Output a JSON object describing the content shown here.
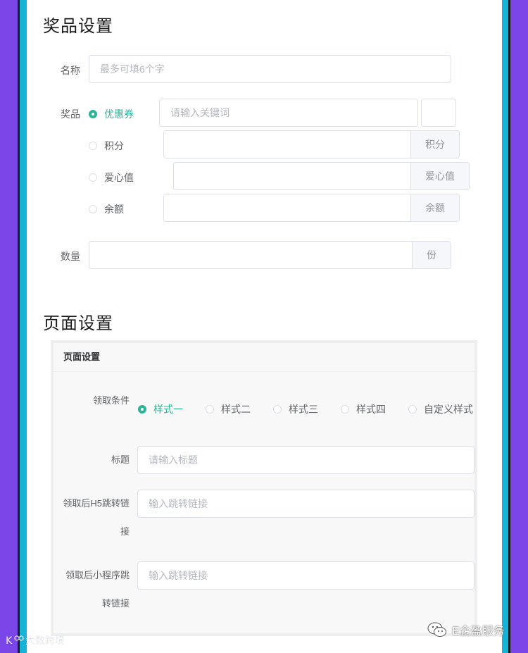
{
  "prize_section": {
    "title": "奖品设置",
    "name_label": "名称",
    "name_placeholder": "最多可填6个字",
    "prize_label": "奖品",
    "prize_types": [
      {
        "label": "优惠券",
        "checked": true,
        "placeholder": "请输入关键词"
      },
      {
        "label": "积分",
        "checked": false,
        "append": "积分"
      },
      {
        "label": "爱心值",
        "checked": false,
        "append": "爱心值"
      },
      {
        "label": "余额",
        "checked": false,
        "append": "余额"
      }
    ],
    "quantity_label": "数量",
    "quantity_append": "份"
  },
  "page_section": {
    "title": "页面设置",
    "card_title": "页面设置",
    "condition_label": "领取条件",
    "styles": [
      {
        "label": "样式一",
        "checked": true
      },
      {
        "label": "样式二",
        "checked": false
      },
      {
        "label": "样式三",
        "checked": false
      },
      {
        "label": "样式四",
        "checked": false
      },
      {
        "label": "自定义样式",
        "checked": false
      }
    ],
    "title_label": "标题",
    "title_placeholder": "请输入标题",
    "h5_label_line1": "领取后H5跳转链",
    "h5_label_line2": "接",
    "h5_placeholder": "输入跳转链接",
    "mini_label_line1": "领取后小程序跳",
    "mini_label_line2": "转链接",
    "mini_placeholder": "输入跳转链接"
  },
  "watermarks": {
    "left": "大数跨境",
    "right": "E企盈服务"
  },
  "colors": {
    "accent": "#2bb597",
    "background_purple": "#7b46e8",
    "border_cyan": "#16b2d8"
  }
}
